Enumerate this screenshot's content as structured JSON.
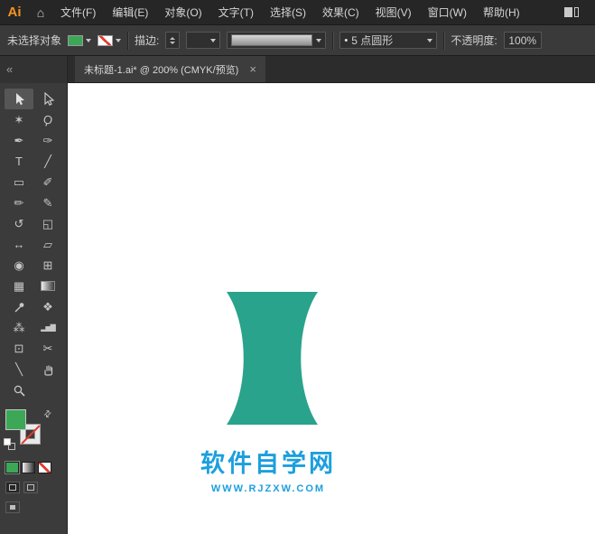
{
  "titlebar": {
    "logo": "Ai",
    "menus": [
      "文件(F)",
      "编辑(E)",
      "对象(O)",
      "文字(T)",
      "选择(S)",
      "效果(C)",
      "视图(V)",
      "窗口(W)",
      "帮助(H)"
    ]
  },
  "icons": {
    "home": "⌂",
    "collapse": "«",
    "swap_fill_stroke": "⇄",
    "brush_dot": "•"
  },
  "control_bar": {
    "selection_status": "未选择对象",
    "stroke_label": "描边:",
    "stroke_weight_value": "",
    "brush_name": "5 点圆形",
    "opacity_label": "不透明度:",
    "opacity_value": "100%"
  },
  "document_tab": {
    "title": "未标题-1.ai* @ 200% (CMYK/预览)",
    "close_glyph": "×"
  },
  "toolbar": {
    "tools": [
      {
        "name": "selection",
        "glyph": ""
      },
      {
        "name": "direct-selection",
        "glyph": ""
      },
      {
        "name": "magic-wand",
        "glyph": "✶"
      },
      {
        "name": "lasso",
        "glyph": "Ϙ"
      },
      {
        "name": "pen",
        "glyph": "✒"
      },
      {
        "name": "curvature",
        "glyph": "✑"
      },
      {
        "name": "type",
        "glyph": "T"
      },
      {
        "name": "line-segment",
        "glyph": "╱"
      },
      {
        "name": "rectangle",
        "glyph": "▭"
      },
      {
        "name": "paintbrush",
        "glyph": "✐"
      },
      {
        "name": "pencil",
        "glyph": "✏"
      },
      {
        "name": "shaper",
        "glyph": "✎"
      },
      {
        "name": "rotate",
        "glyph": "↺"
      },
      {
        "name": "scale",
        "glyph": "◱"
      },
      {
        "name": "width",
        "glyph": "↔"
      },
      {
        "name": "free-transform",
        "glyph": "▱"
      },
      {
        "name": "shape-builder",
        "glyph": "◉"
      },
      {
        "name": "perspective-grid",
        "glyph": "⊞"
      },
      {
        "name": "mesh",
        "glyph": "▦"
      },
      {
        "name": "gradient",
        "glyph": ""
      },
      {
        "name": "eyedropper",
        "glyph": ""
      },
      {
        "name": "blend",
        "glyph": "❖"
      },
      {
        "name": "symbol-sprayer",
        "glyph": "⁂"
      },
      {
        "name": "column-graph",
        "glyph": "▂▅▇"
      },
      {
        "name": "artboard",
        "glyph": "⊡"
      },
      {
        "name": "slice",
        "glyph": "✂"
      },
      {
        "name": "knife",
        "glyph": "╲"
      },
      {
        "name": "hand",
        "glyph": ""
      },
      {
        "name": "zoom",
        "glyph": ""
      }
    ]
  },
  "swatches": {
    "fill_color": "#3BA757",
    "stroke_style": "none",
    "none_slash_color": "#e23b2e"
  },
  "canvas": {
    "shape_fill": "#29A38B",
    "logo_title": "软件自学网",
    "logo_subtitle": "WWW.RJZXW.COM",
    "logo_color": "#1C9FDE"
  }
}
